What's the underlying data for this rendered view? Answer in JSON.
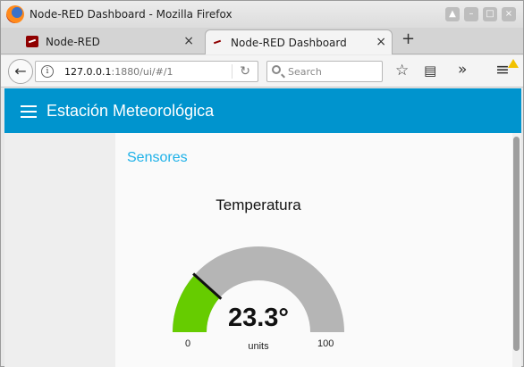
{
  "window": {
    "title": "Node-RED Dashboard - Mozilla Firefox"
  },
  "tabs": [
    {
      "label": "Node-RED",
      "close": "×"
    },
    {
      "label": "Node-RED Dashboard",
      "close": "×"
    }
  ],
  "new_tab_symbol": "+",
  "window_controls": {
    "up": "▲",
    "minimize": "–",
    "maximize": "□",
    "close": "×"
  },
  "navbar": {
    "back_symbol": "←",
    "info_symbol": "i",
    "url_host": "127.0.0.1",
    "url_path": ":1880/ui/#/1",
    "reload_symbol": "↻",
    "search_placeholder": "Search",
    "bookmark_symbol": "☆",
    "reader_symbol": "▤",
    "overflow_symbol": "»",
    "menu_symbol": "≡"
  },
  "dashboard": {
    "title": "Estación Meteorológica",
    "group_title": "Sensores",
    "gauge": {
      "title": "Temperatura",
      "value_text": "23.3°",
      "value": 23.3,
      "min": 0,
      "max": 100,
      "min_label": "0",
      "max_label": "100",
      "units": "units",
      "fill_color": "#66cc00",
      "track_color": "#b5b5b5"
    }
  },
  "colors": {
    "appbar": "#0094ce",
    "group_title": "#1db1e8"
  }
}
